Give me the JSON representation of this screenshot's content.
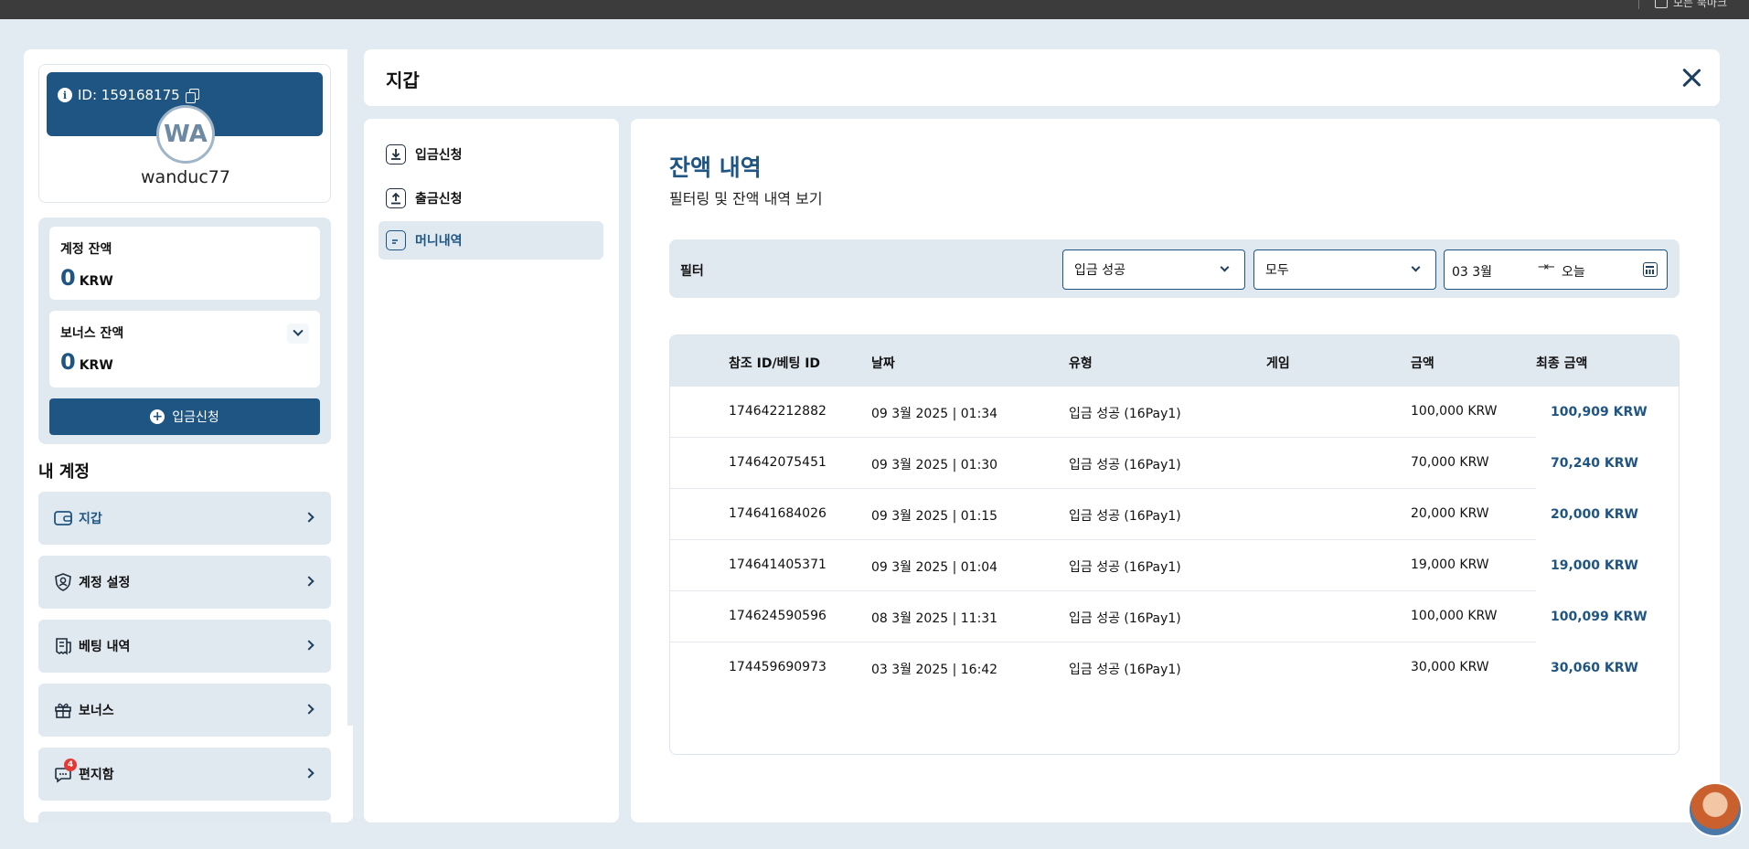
{
  "browser": {
    "bookmarks_label": "모든 북마크"
  },
  "profile": {
    "id_label": "ID: 159168175",
    "avatar_initials": "WA",
    "username": "wanduc77"
  },
  "balances": {
    "account_label": "계정 잔액",
    "account_value": "0",
    "account_currency": "KRW",
    "bonus_label": "보너스 잔액",
    "bonus_value": "0",
    "bonus_currency": "KRW",
    "deposit_button": "입금신청"
  },
  "my_account": {
    "title": "내 계정",
    "items": [
      {
        "label": "지갑",
        "icon": "wallet-icon",
        "active": true
      },
      {
        "label": "계정 설정",
        "icon": "user-shield-icon"
      },
      {
        "label": "베팅 내역",
        "icon": "receipt-icon"
      },
      {
        "label": "보너스",
        "icon": "gift-icon"
      },
      {
        "label": "편지함",
        "icon": "chat-icon",
        "badge": "4"
      }
    ]
  },
  "header": {
    "title": "지갑"
  },
  "subnav": {
    "items": [
      {
        "label": "입금신청",
        "icon": "download-icon"
      },
      {
        "label": "출금신청",
        "icon": "upload-icon"
      },
      {
        "label": "머니내역",
        "icon": "document-icon",
        "active": true
      }
    ]
  },
  "content": {
    "title": "잔액 내역",
    "subtitle": "필터링 및 잔액 내역 보기",
    "filter": {
      "label": "필터",
      "status_value": "입금 성공",
      "type_value": "모두",
      "date_from": "03 3월",
      "date_to": "오늘"
    },
    "table": {
      "columns": [
        "참조 ID/베팅 ID",
        "날짜",
        "유형",
        "게임",
        "금액",
        "최종 금액"
      ],
      "rows": [
        [
          "174642212882",
          "09 3월 2025 | 01:34",
          "입금 성공 (16Pay1)",
          "",
          "100,000 KRW",
          "100,909 KRW"
        ],
        [
          "174642075451",
          "09 3월 2025 | 01:30",
          "입금 성공 (16Pay1)",
          "",
          "70,000 KRW",
          "70,240 KRW"
        ],
        [
          "174641684026",
          "09 3월 2025 | 01:15",
          "입금 성공 (16Pay1)",
          "",
          "20,000 KRW",
          "20,000 KRW"
        ],
        [
          "174641405371",
          "09 3월 2025 | 01:04",
          "입금 성공 (16Pay1)",
          "",
          "19,000 KRW",
          "19,000 KRW"
        ],
        [
          "174624590596",
          "08 3월 2025 | 11:31",
          "입금 성공 (16Pay1)",
          "",
          "100,000 KRW",
          "100,099 KRW"
        ],
        [
          "174459690973",
          "03 3월 2025 | 16:42",
          "입금 성공 (16Pay1)",
          "",
          "30,000 KRW",
          "30,060 KRW"
        ]
      ]
    }
  },
  "colors": {
    "primary": "#1f5583",
    "background": "#e3ebf2",
    "panel": "#ffffff",
    "light": "#e1e9f0",
    "badge": "#e53935"
  }
}
